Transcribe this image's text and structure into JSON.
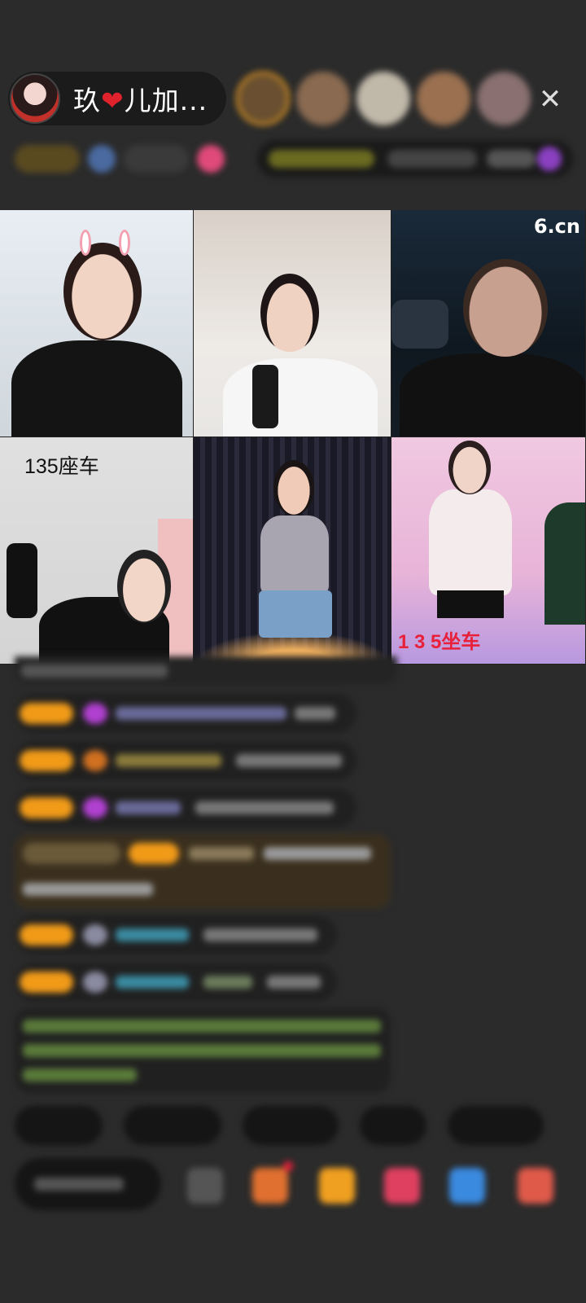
{
  "host": {
    "name": "玖❤️儿加...",
    "name_parts": [
      "玖",
      "❤️",
      "儿加..."
    ]
  },
  "header": {
    "close_icon": "close-icon"
  },
  "grid": {
    "cells": [
      {
        "label": ""
      },
      {
        "label": ""
      },
      {
        "label": "",
        "logo": "6.cn"
      },
      {
        "label": "135座车"
      },
      {
        "label": ""
      },
      {
        "label": "1 3 5坐车"
      }
    ]
  },
  "chat": {
    "note": ""
  },
  "colors": {
    "accent_gold": "#f0a020",
    "badge_orange": "#f09a18",
    "chat_green": "#7cc04a",
    "brand_red": "#e8203a"
  }
}
